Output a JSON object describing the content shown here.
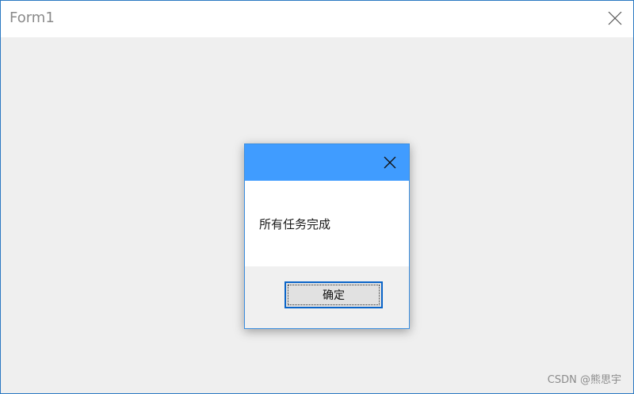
{
  "window": {
    "title": "Form1",
    "close_icon": "close-icon"
  },
  "dialog": {
    "title_color": "#409cff",
    "close_icon": "close-icon",
    "message": "所有任务完成",
    "ok_label": "确定"
  },
  "watermark": {
    "text": "CSDN @熊思宇"
  },
  "colors": {
    "window_border": "#2b79c2",
    "client_bg": "#efefef",
    "dialog_header": "#409cff",
    "button_focus_border": "#0a64c8"
  }
}
